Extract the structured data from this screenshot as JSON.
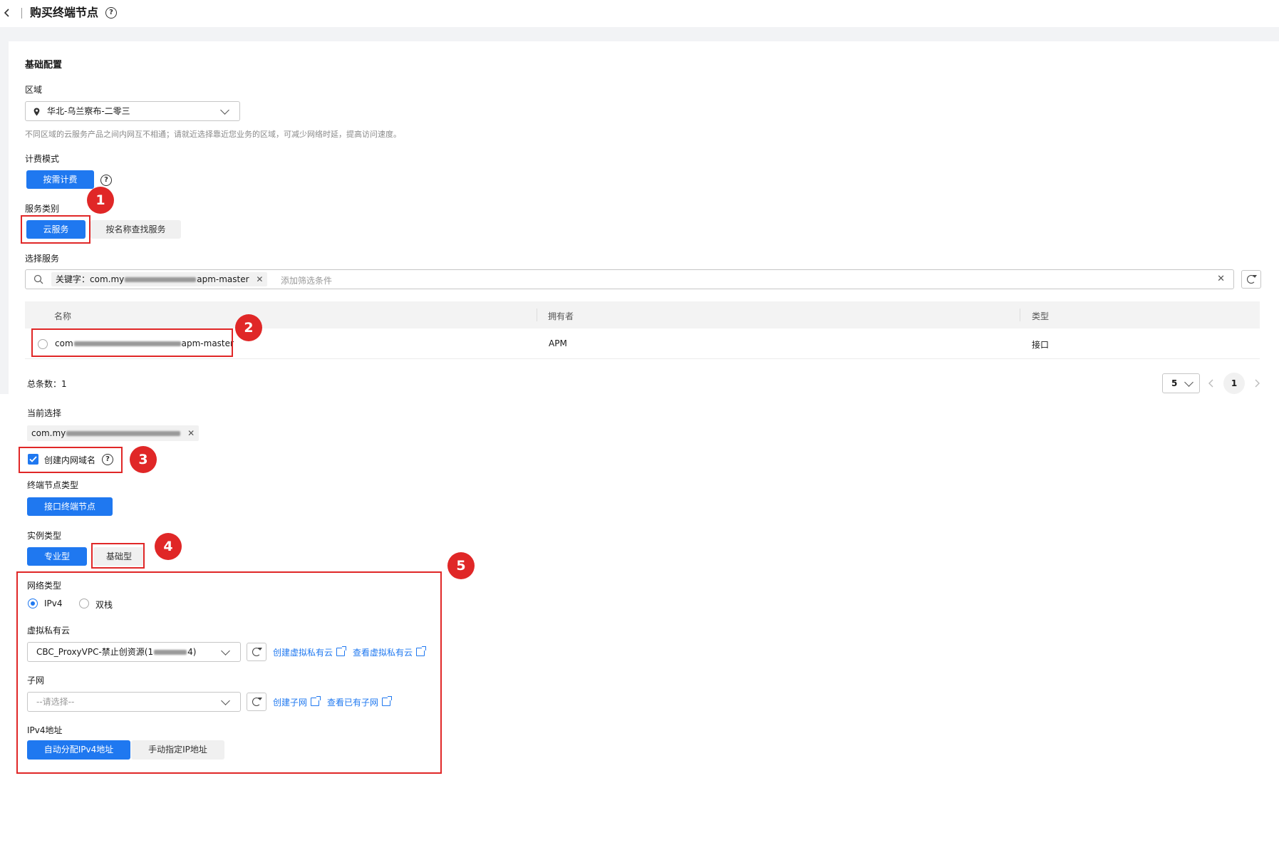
{
  "header": {
    "title": "购买终端节点"
  },
  "basic": {
    "section_title": "基础配置",
    "region_label": "区域",
    "region_value": "华北-乌兰察布-二零三",
    "region_hint": "不同区域的云服务产品之间内网互不相通；请就近选择靠近您业务的区域，可减少网络时延，提高访问速度。",
    "billing_label": "计费模式",
    "billing_option": "按需计费",
    "service_category_label": "服务类别",
    "service_category_options": [
      "云服务",
      "按名称查找服务"
    ],
    "select_service_label": "选择服务",
    "search_chip_prefix": "关键字：com.my",
    "search_chip_suffix": "apm-master",
    "search_placeholder": "添加筛选条件",
    "table": {
      "columns": [
        "名称",
        "拥有者",
        "类型"
      ],
      "rows": [
        {
          "name_prefix": "com",
          "name_suffix": "apm-master",
          "owner": "APM",
          "type": "接口"
        }
      ]
    },
    "total_label": "总条数：",
    "total_count": "1",
    "page_size": "5",
    "current_page": "1",
    "current_selection_label": "当前选择",
    "current_selection_prefix": "com.my",
    "create_dns_label": "创建内网域名",
    "endpoint_type_label": "终端节点类型",
    "endpoint_type_option": "接口终端节点",
    "instance_type_label": "实例类型",
    "instance_type_options": [
      "专业型",
      "基础型"
    ],
    "network_type_label": "网络类型",
    "network_type_options": [
      "IPv4",
      "双栈"
    ],
    "vpc_label": "虚拟私有云",
    "vpc_value_prefix": "CBC_ProxyVPC-禁止创资源(1",
    "vpc_value_suffix": "4)",
    "vpc_links": [
      "创建虚拟私有云",
      "查看虚拟私有云"
    ],
    "subnet_label": "子网",
    "subnet_placeholder": "--请选择--",
    "subnet_links": [
      "创建子网",
      "查看已有子网"
    ],
    "ipv4_label": "IPv4地址",
    "ipv4_options": [
      "自动分配IPv4地址",
      "手动指定IP地址"
    ]
  },
  "annotations": [
    "1",
    "2",
    "3",
    "4",
    "5"
  ],
  "colors": {
    "primary": "#1f78f0",
    "annotation": "#e02727"
  }
}
